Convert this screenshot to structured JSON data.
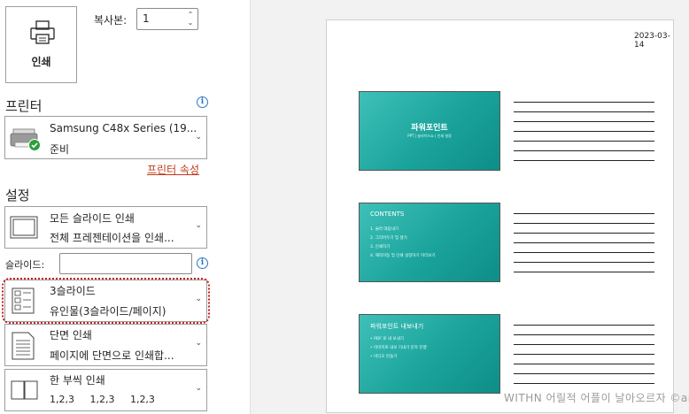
{
  "print_button": {
    "label": "인쇄",
    "icon": "printer-icon"
  },
  "copies": {
    "label": "복사본:",
    "value": "1"
  },
  "printer": {
    "section_title": "프린터",
    "name": "Samsung C48x Series (19...",
    "status": "준비",
    "properties_link": "프린터 속성"
  },
  "settings": {
    "section_title": "설정",
    "range": {
      "title": "모든 슬라이드 인쇄",
      "subtitle": "전체 프레젠테이션을 인쇄..."
    },
    "slides_label": "슬라이드:",
    "slides_value": "",
    "layout": {
      "title": "3슬라이드",
      "subtitle": "유인물(3슬라이드/페이지)"
    },
    "sides": {
      "title": "단면 인쇄",
      "subtitle": "페이지에 단면으로 인쇄합..."
    },
    "collate": {
      "title": "한 부씩 인쇄",
      "subtitle": "1,2,3     1,2,3     1,2,3"
    }
  },
  "preview": {
    "date": "2023-03-14",
    "slides": [
      {
        "title": "파워포인트",
        "subtitle": "PPT | 슬라이드쇼 | 인쇄 설정"
      },
      {
        "title": "CONTENTS",
        "items": [
          "1. 슬라 대답내기",
          "2. 그리어두기 및 생기",
          "3. 인쇄하기",
          "4. 재작이동 및 인쇄 설정하기 미리보기"
        ]
      },
      {
        "title": "파워포인트 내보내기",
        "items": [
          "• PDF 로 내 보내기",
          "• 이미지로 내보 기내기 문자 진행",
          "• 비디오 만들기"
        ]
      }
    ]
  },
  "watermark": "WITHN 어릴적 어플이 날아오르자 ©anne"
}
